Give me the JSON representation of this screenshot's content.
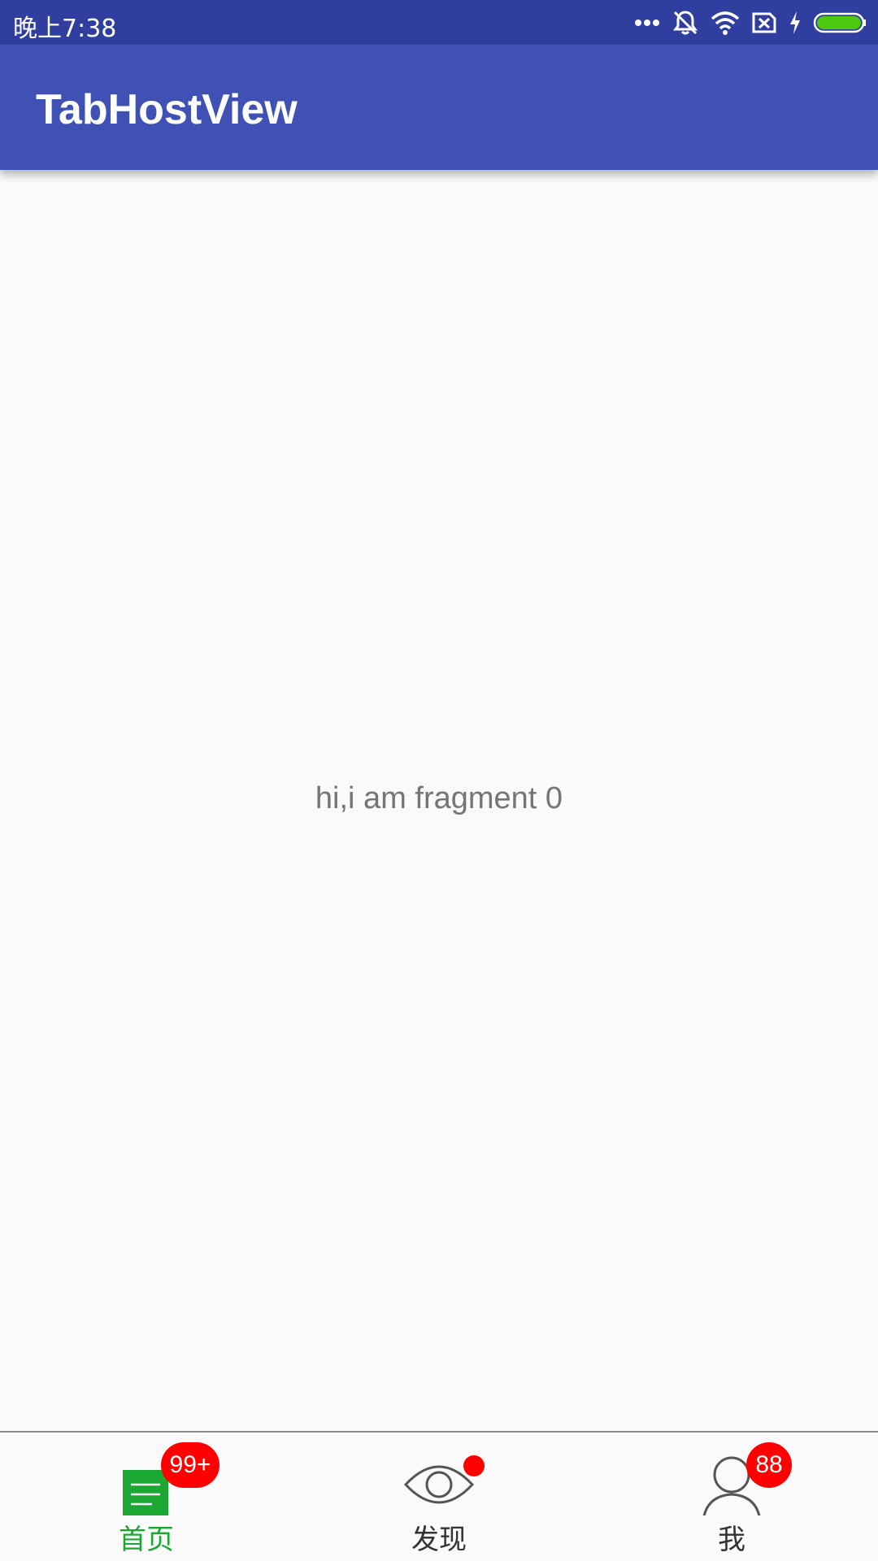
{
  "status_bar": {
    "time": "晚上7:38",
    "icons": [
      "more-dots-icon",
      "mute-icon",
      "wifi-icon",
      "sim-x-icon",
      "charging-icon",
      "battery-icon"
    ],
    "battery_color": "#4cc80f"
  },
  "app_bar": {
    "title": "TabHostView",
    "color": "#3f51b5"
  },
  "content": {
    "text": "hi,i am fragment 0"
  },
  "tabs": [
    {
      "label": "首页",
      "icon": "home-list-icon",
      "selected": true,
      "badge": "99+",
      "color": "#1aa832"
    },
    {
      "label": "发现",
      "icon": "eye-icon",
      "selected": false,
      "dot": true,
      "color": "#333333"
    },
    {
      "label": "我",
      "icon": "person-icon",
      "selected": false,
      "badge": "88",
      "color": "#333333"
    }
  ]
}
